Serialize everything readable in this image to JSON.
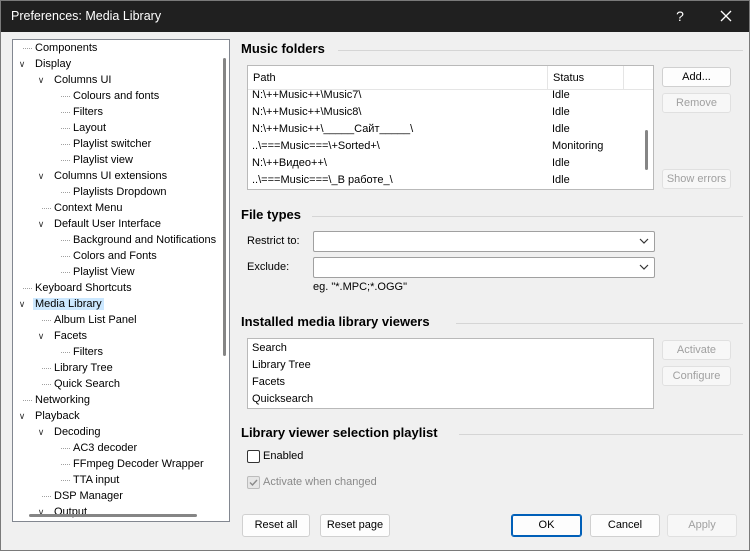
{
  "window": {
    "title": "Preferences: Media Library",
    "help": "?"
  },
  "tree": {
    "items": [
      {
        "label": "Components",
        "level": 0,
        "expander": "none",
        "selected": false
      },
      {
        "label": "Display",
        "level": 0,
        "expander": "open",
        "selected": false
      },
      {
        "label": "Columns UI",
        "level": 1,
        "expander": "open",
        "selected": false
      },
      {
        "label": "Colours and fonts",
        "level": 2,
        "expander": "none",
        "selected": false
      },
      {
        "label": "Filters",
        "level": 2,
        "expander": "none",
        "selected": false
      },
      {
        "label": "Layout",
        "level": 2,
        "expander": "none",
        "selected": false
      },
      {
        "label": "Playlist switcher",
        "level": 2,
        "expander": "none",
        "selected": false
      },
      {
        "label": "Playlist view",
        "level": 2,
        "expander": "none",
        "selected": false
      },
      {
        "label": "Columns UI extensions",
        "level": 1,
        "expander": "open",
        "selected": false
      },
      {
        "label": "Playlists Dropdown",
        "level": 2,
        "expander": "none",
        "selected": false
      },
      {
        "label": "Context Menu",
        "level": 1,
        "expander": "none",
        "selected": false
      },
      {
        "label": "Default User Interface",
        "level": 1,
        "expander": "open",
        "selected": false
      },
      {
        "label": "Background and Notifications",
        "level": 2,
        "expander": "none",
        "selected": false
      },
      {
        "label": "Colors and Fonts",
        "level": 2,
        "expander": "none",
        "selected": false
      },
      {
        "label": "Playlist View",
        "level": 2,
        "expander": "none",
        "selected": false
      },
      {
        "label": "Keyboard Shortcuts",
        "level": 0,
        "expander": "none",
        "selected": false
      },
      {
        "label": "Media Library",
        "level": 0,
        "expander": "open",
        "selected": true
      },
      {
        "label": "Album List Panel",
        "level": 1,
        "expander": "none",
        "selected": false
      },
      {
        "label": "Facets",
        "level": 1,
        "expander": "open",
        "selected": false
      },
      {
        "label": "Filters",
        "level": 2,
        "expander": "none",
        "selected": false
      },
      {
        "label": "Library Tree",
        "level": 1,
        "expander": "none",
        "selected": false
      },
      {
        "label": "Quick Search",
        "level": 1,
        "expander": "none",
        "selected": false
      },
      {
        "label": "Networking",
        "level": 0,
        "expander": "none",
        "selected": false
      },
      {
        "label": "Playback",
        "level": 0,
        "expander": "open",
        "selected": false
      },
      {
        "label": "Decoding",
        "level": 1,
        "expander": "open",
        "selected": false
      },
      {
        "label": "AC3 decoder",
        "level": 2,
        "expander": "none",
        "selected": false
      },
      {
        "label": "FFmpeg Decoder Wrapper",
        "level": 2,
        "expander": "none",
        "selected": false
      },
      {
        "label": "TTA input",
        "level": 2,
        "expander": "none",
        "selected": false
      },
      {
        "label": "DSP Manager",
        "level": 1,
        "expander": "none",
        "selected": false
      },
      {
        "label": "Output",
        "level": 1,
        "expander": "open",
        "selected": false
      }
    ]
  },
  "music_folders": {
    "title": "Music folders",
    "columns": [
      "Path",
      "Status"
    ],
    "rows": [
      {
        "path": "N:\\++Music++\\Music7\\",
        "status": "Idle"
      },
      {
        "path": "N:\\++Music++\\Music8\\",
        "status": "Idle"
      },
      {
        "path": "N:\\++Music++\\_____Сайт_____\\",
        "status": "Idle"
      },
      {
        "path": "..\\===Music===\\+Sorted+\\",
        "status": "Monitoring"
      },
      {
        "path": "N:\\++Видео++\\",
        "status": "Idle"
      },
      {
        "path": "..\\===Music===\\_В работе_\\",
        "status": "Idle"
      }
    ],
    "add_label": "Add...",
    "remove_label": "Remove",
    "show_errors_label": "Show errors"
  },
  "file_types": {
    "title": "File types",
    "restrict_label": "Restrict to:",
    "restrict_value": "",
    "exclude_label": "Exclude:",
    "exclude_value": "",
    "hint": "eg. \"*.MPC;*.OGG\""
  },
  "viewers": {
    "title": "Installed media library viewers",
    "items": [
      "Search",
      "Library Tree",
      "Facets",
      "Quicksearch"
    ],
    "activate_label": "Activate",
    "configure_label": "Configure"
  },
  "selection_playlist": {
    "title": "Library viewer selection playlist",
    "enabled_label": "Enabled",
    "enabled_checked": false,
    "activate_label": "Activate when changed",
    "activate_checked": true
  },
  "footer": {
    "reset_all": "Reset all",
    "reset_page": "Reset page",
    "ok": "OK",
    "cancel": "Cancel",
    "apply": "Apply"
  }
}
